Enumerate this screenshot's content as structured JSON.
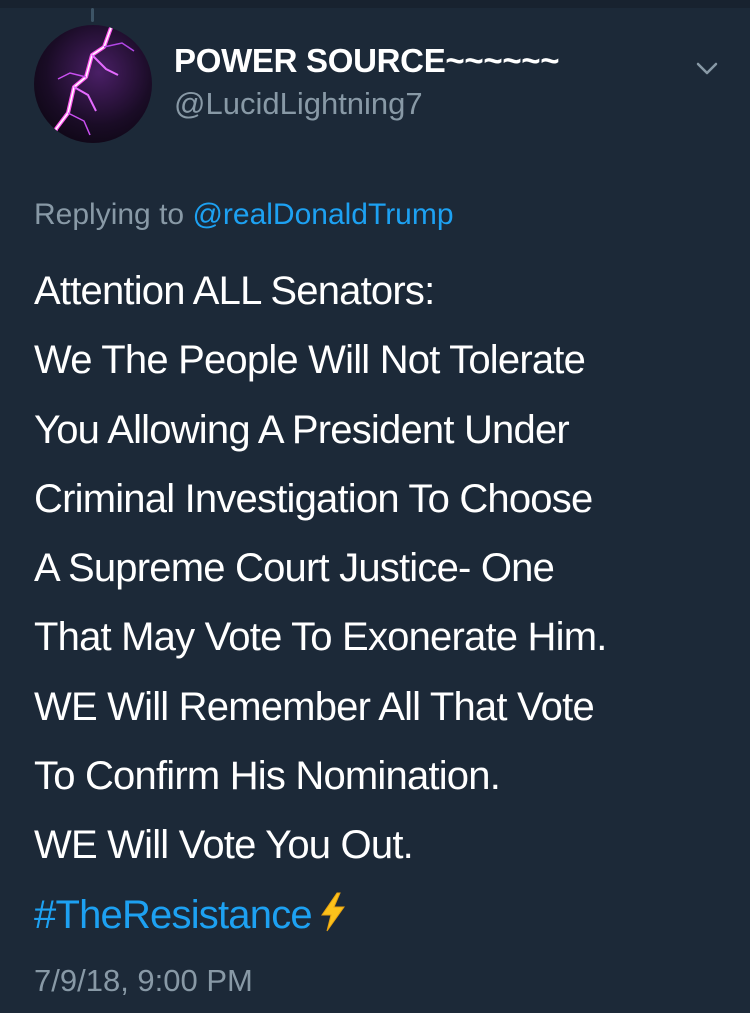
{
  "tweet": {
    "display_name": "POWER SOURCE~~~~~~",
    "handle": "@LucidLightning7",
    "replying_prefix": "Replying to",
    "replying_to": "@realDonaldTrump",
    "lines": [
      "Attention ALL Senators:",
      "We The People Will Not Tolerate",
      "You Allowing A President Under",
      "Criminal Investigation To Choose",
      "A Supreme Court Justice- One",
      "That May Vote To Exonerate Him.",
      "WE Will Remember All That Vote",
      "To Confirm His Nomination.",
      "WE Will Vote You Out."
    ],
    "hashtag": "#TheResistance",
    "timestamp": "7/9/18, 9:00 PM"
  },
  "icons": {
    "avatar": "lightning-avatar",
    "menu": "chevron-down-icon",
    "emoji": "lightning-emoji-icon"
  },
  "colors": {
    "background": "#1c2938",
    "text": "#ffffff",
    "secondary": "#8899a6",
    "link": "#1da1f2"
  }
}
